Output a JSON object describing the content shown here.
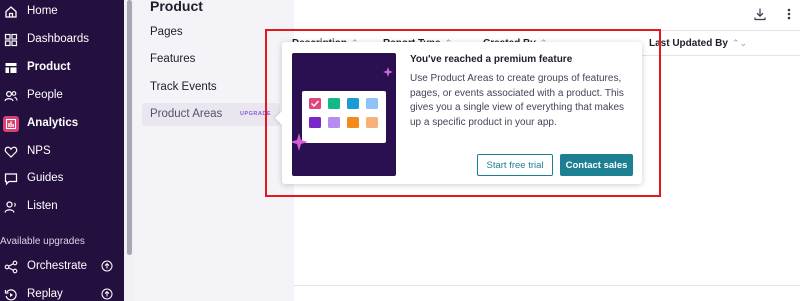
{
  "nav": {
    "items": [
      {
        "label": "Home",
        "icon": "home-icon"
      },
      {
        "label": "Dashboards",
        "icon": "dashboards-icon"
      },
      {
        "label": "Product",
        "icon": "product-icon"
      },
      {
        "label": "People",
        "icon": "people-icon"
      },
      {
        "label": "Analytics",
        "icon": "analytics-icon"
      },
      {
        "label": "NPS",
        "icon": "heart-icon"
      },
      {
        "label": "Guides",
        "icon": "guides-icon"
      },
      {
        "label": "Listen",
        "icon": "listen-icon"
      }
    ],
    "section_label": "Available upgrades",
    "upgrades": [
      {
        "label": "Orchestrate",
        "icon": "orchestrate-icon"
      },
      {
        "label": "Replay",
        "icon": "replay-icon"
      }
    ],
    "active_color": "#d83f75",
    "background": "#24103f"
  },
  "subnav": {
    "title": "Product",
    "items": [
      {
        "label": "Pages"
      },
      {
        "label": "Features"
      },
      {
        "label": "Track Events"
      },
      {
        "label": "Product Areas",
        "tag": "UPGRADE"
      }
    ]
  },
  "table": {
    "columns": [
      {
        "label": "Description"
      },
      {
        "label": "Report Type"
      },
      {
        "label": "Created By"
      },
      {
        "label": "Last Updated By"
      }
    ]
  },
  "popover": {
    "title": "You've reached a premium feature",
    "body": "Use Product Areas to create groups of features, pages, or events associated with a product. This gives you a single view of everything that makes up a specific product in your app.",
    "trial_label": "Start free trial",
    "sales_label": "Contact sales",
    "accent": "#1c7f92"
  },
  "highlight_color": "#e8161e"
}
